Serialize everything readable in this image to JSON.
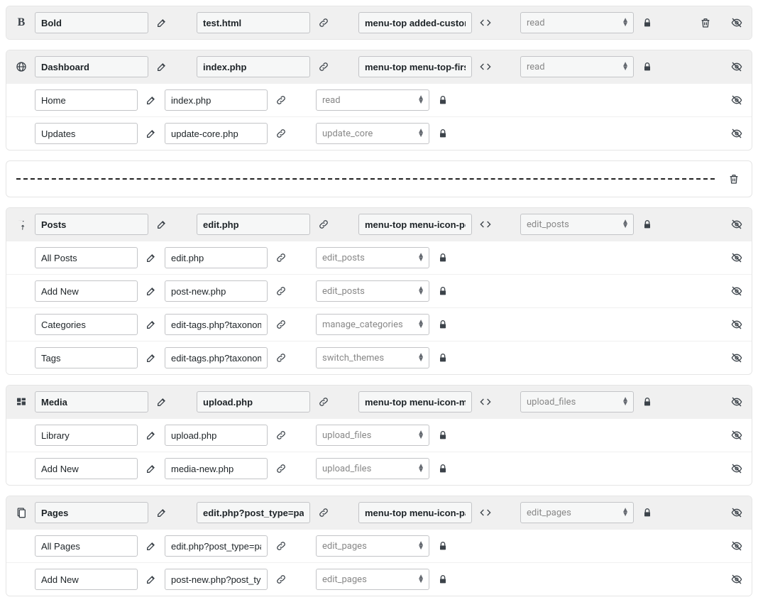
{
  "sections": [
    {
      "icon": "bold",
      "title": "Bold",
      "url": "test.html",
      "classes": "menu-top added-custom",
      "capability": "read",
      "hasTrash": true,
      "subs": []
    },
    {
      "icon": "globe",
      "title": "Dashboard",
      "url": "index.php",
      "classes": "menu-top menu-top-first",
      "capability": "read",
      "hasTrash": false,
      "subs": [
        {
          "title": "Home",
          "url": "index.php",
          "capability": "read"
        },
        {
          "title": "Updates",
          "url": "update-core.php",
          "capability": "update_core"
        }
      ]
    },
    {
      "separator": true
    },
    {
      "icon": "pin",
      "title": "Posts",
      "url": "edit.php",
      "classes": "menu-top menu-icon-posts",
      "capability": "edit_posts",
      "hasTrash": false,
      "subs": [
        {
          "title": "All Posts",
          "url": "edit.php",
          "capability": "edit_posts"
        },
        {
          "title": "Add New",
          "url": "post-new.php",
          "capability": "edit_posts"
        },
        {
          "title": "Categories",
          "url": "edit-tags.php?taxonomy=category",
          "capability": "manage_categories"
        },
        {
          "title": "Tags",
          "url": "edit-tags.php?taxonomy=post_tag",
          "capability": "switch_themes"
        }
      ]
    },
    {
      "icon": "media",
      "title": "Media",
      "url": "upload.php",
      "classes": "menu-top menu-icon-media",
      "capability": "upload_files",
      "hasTrash": false,
      "subs": [
        {
          "title": "Library",
          "url": "upload.php",
          "capability": "upload_files"
        },
        {
          "title": "Add New",
          "url": "media-new.php",
          "capability": "upload_files"
        }
      ]
    },
    {
      "icon": "pages",
      "title": "Pages",
      "url": "edit.php?post_type=page",
      "classes": "menu-top menu-icon-pages",
      "capability": "edit_pages",
      "hasTrash": false,
      "subs": [
        {
          "title": "All Pages",
          "url": "edit.php?post_type=page",
          "capability": "edit_pages"
        },
        {
          "title": "Add New",
          "url": "post-new.php?post_type=page",
          "capability": "edit_pages"
        }
      ]
    }
  ]
}
